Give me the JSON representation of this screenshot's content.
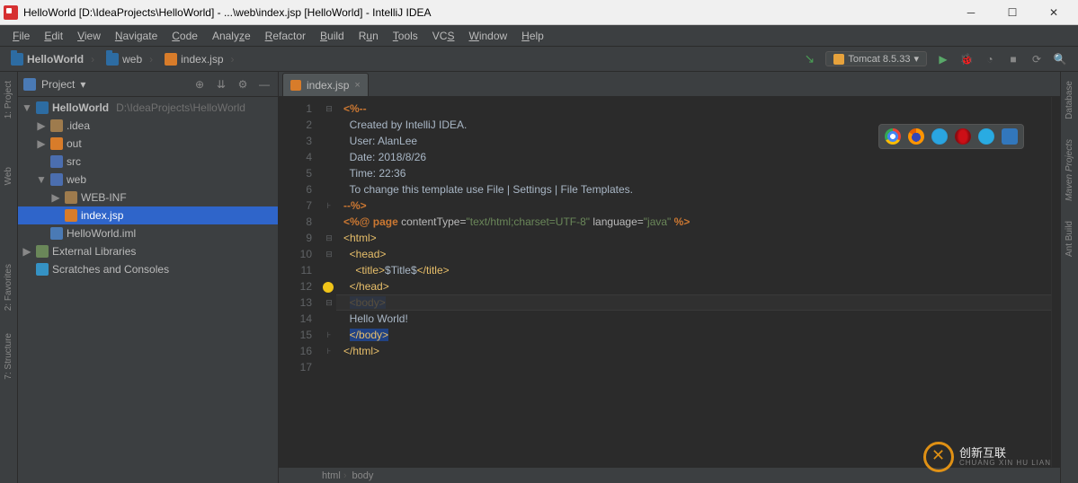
{
  "window": {
    "title": "HelloWorld [D:\\IdeaProjects\\HelloWorld] - ...\\web\\index.jsp [HelloWorld] - IntelliJ IDEA"
  },
  "menu": [
    "File",
    "Edit",
    "View",
    "Navigate",
    "Code",
    "Analyze",
    "Refactor",
    "Build",
    "Run",
    "Tools",
    "VCS",
    "Window",
    "Help"
  ],
  "breadcrumb": [
    {
      "icon": "module",
      "label": "HelloWorld"
    },
    {
      "icon": "folder",
      "label": "web"
    },
    {
      "icon": "jsp",
      "label": "index.jsp"
    }
  ],
  "run_config": {
    "label": "Tomcat 8.5.33",
    "dropdown": "▾"
  },
  "project_panel": {
    "title": "Project",
    "dropdown": "▾"
  },
  "tree": {
    "root": {
      "name": "HelloWorld",
      "path": "D:\\IdeaProjects\\HelloWorld"
    },
    "idea": ".idea",
    "out": "out",
    "src": "src",
    "web": "web",
    "webinf": "WEB-INF",
    "indexjsp": "index.jsp",
    "iml": "HelloWorld.iml",
    "ext": "External Libraries",
    "scratch": "Scratches and Consoles"
  },
  "left_rail": [
    "1: Project",
    "Web",
    "2: Favorites",
    "7: Structure"
  ],
  "right_rail": [
    "Database",
    "Maven Projects",
    "Ant Build"
  ],
  "editor": {
    "tab": {
      "name": "index.jsp"
    },
    "lines": [
      "<%--",
      "  Created by IntelliJ IDEA.",
      "  User: AlanLee",
      "  Date: 2018/8/26",
      "  Time: 22:36",
      "  To change this template use File | Settings | File Templates.",
      "--%>",
      "<%@ page contentType=\"text/html;charset=UTF-8\" language=\"java\" %>",
      "<html>",
      "  <head>",
      "    <title>$Title$</title>",
      "  </head>",
      "  <body>",
      "  Hello World!",
      "  </body>",
      "</html>",
      ""
    ],
    "bottom_breadcrumb": [
      "html",
      "body"
    ]
  },
  "watermark": {
    "main": "创新互联",
    "sub": "CHUANG XIN HU LIAN"
  }
}
